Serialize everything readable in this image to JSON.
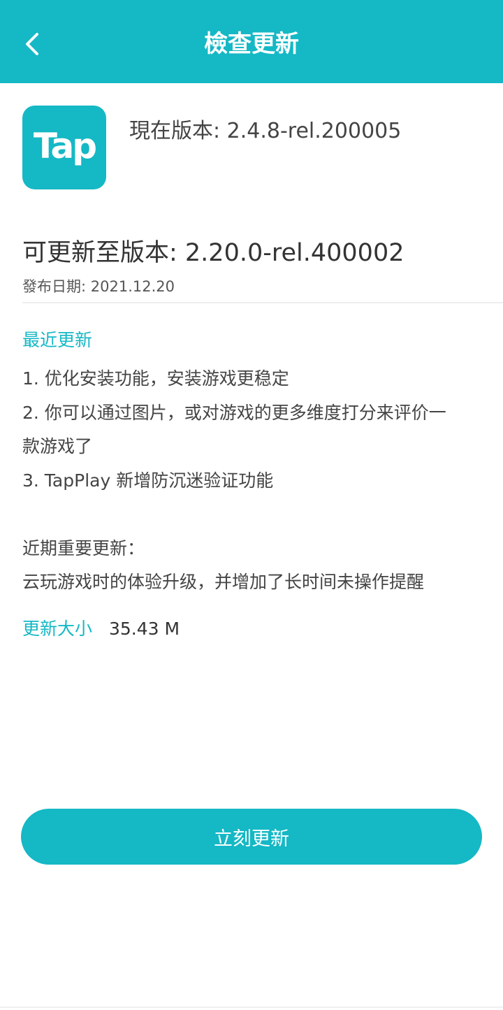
{
  "header": {
    "title": "檢查更新",
    "back_icon": "chevron-left-icon"
  },
  "app": {
    "icon_text": "Tap",
    "current_version": "現在版本: 2.4.8-rel.200005"
  },
  "update": {
    "new_version": "可更新至版本: 2.20.0-rel.400002",
    "release_date": "發布日期: 2021.12.20",
    "section_title": "最近更新",
    "notes": [
      "1. 优化安装功能，安装游戏更稳定",
      "2. 你可以通过图片，或对游戏的更多维度打分来评价一",
      "款游戏了",
      "3. TapPlay 新增防沉迷验证功能",
      "",
      "近期重要更新：",
      "云玩游戏时的体验升级，并增加了长时间未操作提醒"
    ],
    "size_label": "更新大小",
    "size_value": "35.43 M",
    "button_label": "立刻更新"
  },
  "colors": {
    "accent": "#15B8C5",
    "text": "#333333",
    "background": "#FFFFFF"
  }
}
